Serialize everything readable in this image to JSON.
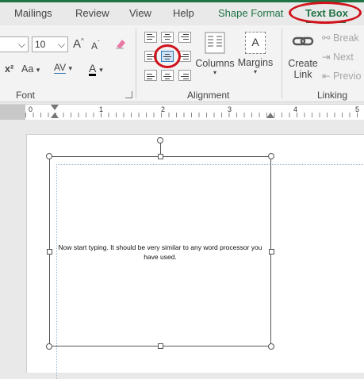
{
  "tabs": [
    {
      "label": "Mailings"
    },
    {
      "label": "Review"
    },
    {
      "label": "View"
    },
    {
      "label": "Help"
    },
    {
      "label": "Shape Format"
    },
    {
      "label": "Text Box"
    }
  ],
  "font_group": {
    "size_value": "10",
    "grow_label": "A",
    "shrink_label": "A",
    "case_label": "Aa",
    "spacing_label": "AV",
    "color_label": "A",
    "superscript_label": "x²",
    "group_label": "Font"
  },
  "alignment_group": {
    "columns_label": "Columns",
    "margins_label": "Margins",
    "margins_icon_label": "A",
    "group_label": "Alignment"
  },
  "linking_group": {
    "create_label": "Create",
    "link_label": "Link",
    "break_label": "Break",
    "next_label": "Next",
    "previous_label": "Previo",
    "group_label": "Linking"
  },
  "ruler": {
    "marks": [
      "0",
      "1",
      "2",
      "3",
      "4",
      "5"
    ]
  },
  "document": {
    "textbox_text": "Now start typing.  It should be very similar to any word processor you have used."
  },
  "colors": {
    "accent_green": "#217346",
    "highlight_red": "#d0121b"
  }
}
